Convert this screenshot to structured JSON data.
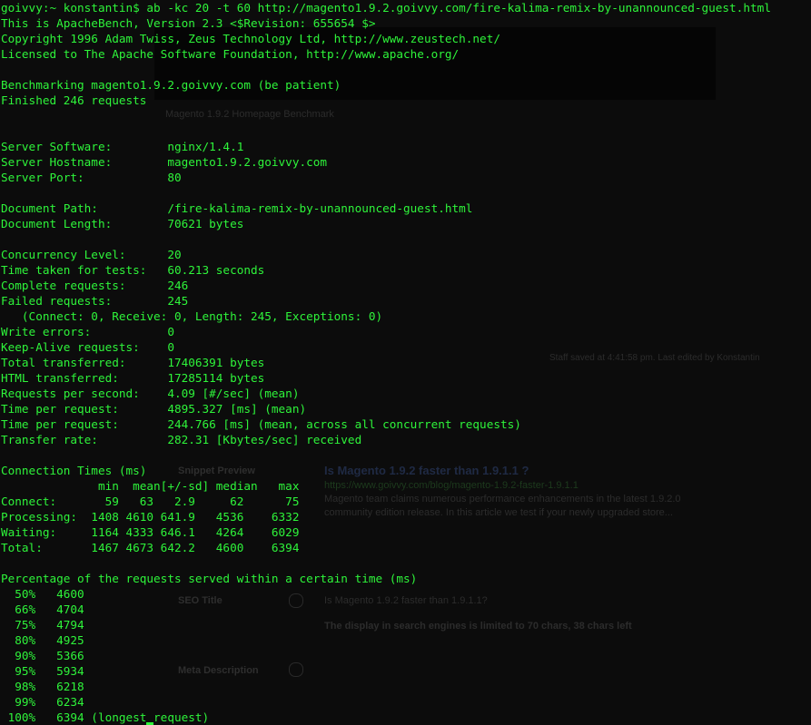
{
  "terminal": {
    "lines": [
      "goivvy:~ konstantin$ ab -kc 20 -t 60 http://magento1.9.2.goivvy.com/fire-kalima-remix-by-unannounced-guest.html",
      "This is ApacheBench, Version 2.3 <$Revision: 655654 $>",
      "Copyright 1996 Adam Twiss, Zeus Technology Ltd, http://www.zeustech.net/",
      "Licensed to The Apache Software Foundation, http://www.apache.org/",
      "",
      "Benchmarking magento1.9.2.goivvy.com (be patient)",
      "Finished 246 requests",
      "",
      "",
      "Server Software:        nginx/1.4.1",
      "Server Hostname:        magento1.9.2.goivvy.com",
      "Server Port:            80",
      "",
      "Document Path:          /fire-kalima-remix-by-unannounced-guest.html",
      "Document Length:        70621 bytes",
      "",
      "Concurrency Level:      20",
      "Time taken for tests:   60.213 seconds",
      "Complete requests:      246",
      "Failed requests:        245",
      "   (Connect: 0, Receive: 0, Length: 245, Exceptions: 0)",
      "Write errors:           0",
      "Keep-Alive requests:    0",
      "Total transferred:      17406391 bytes",
      "HTML transferred:       17285114 bytes",
      "Requests per second:    4.09 [#/sec] (mean)",
      "Time per request:       4895.327 [ms] (mean)",
      "Time per request:       244.766 [ms] (mean, across all concurrent requests)",
      "Transfer rate:          282.31 [Kbytes/sec] received",
      "",
      "Connection Times (ms)",
      "              min  mean[+/-sd] median   max",
      "Connect:       59   63   2.9     62      75",
      "Processing:  1408 4610 641.9   4536    6332",
      "Waiting:     1164 4333 646.1   4264    6029",
      "Total:       1467 4673 642.2   4600    6394",
      "",
      "Percentage of the requests served within a certain time (ms)",
      "  50%   4600",
      "  66%   4704",
      "  75%   4794",
      "  80%   4925",
      "  90%   5366",
      "  95%   5934",
      "  98%   6218",
      "  99%   6234",
      " 100%   6394 (longest request)"
    ]
  },
  "background": {
    "ghost_items": [
      "Magento 1.9.2 Homepage Benchmark",
      "Is Magento 1.9.2 faster than 1.9.1.1 ?",
      "https://www.goivvy.com/blog/magento-1.9.2-faster-1.9.1.1",
      "Magento team claims numerous performance enhancements in the latest 1.9.2.0",
      "community edition release. In this article we test if your newly upgraded store...",
      "Staff saved at 4:41:58 pm. Last edited by Konstantin",
      "Snippet Preview",
      "SEO Title",
      "Is Magento 1.9.2 faster than 1.9.1.1?",
      "The display in search engines is limited to 70 chars, 38 chars left",
      "Meta Description"
    ]
  },
  "colors": {
    "terminal_text": "#2ef43a",
    "background": "#0c0c0c"
  }
}
